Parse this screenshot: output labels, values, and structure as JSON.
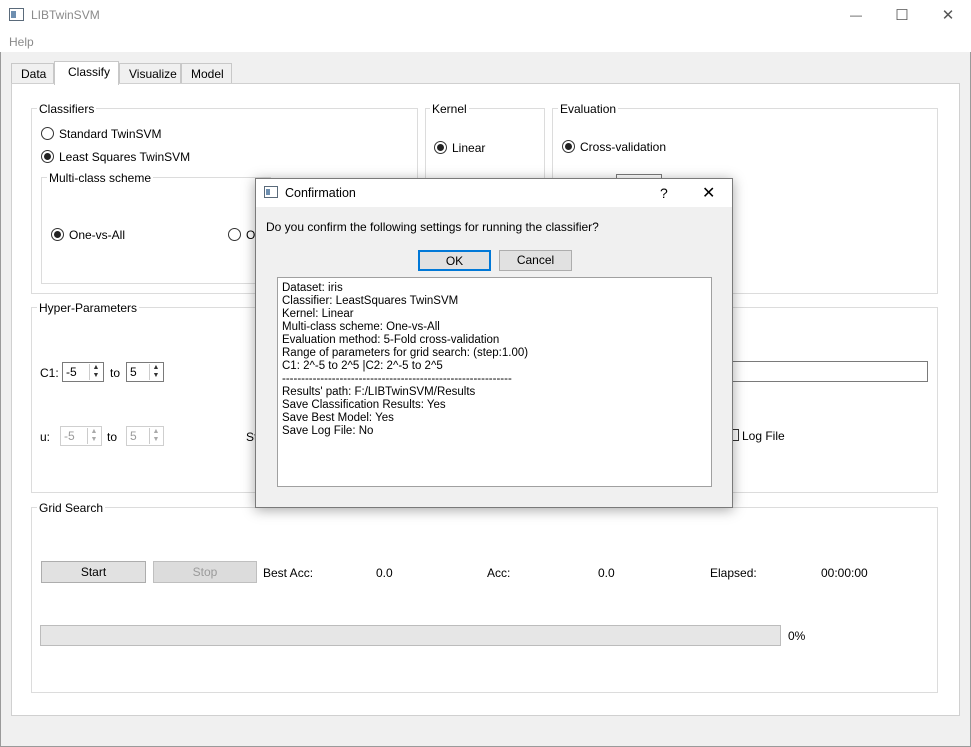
{
  "window": {
    "title": "LIBTwinSVM",
    "minimize": "—",
    "maximize": "☐",
    "close": "✕"
  },
  "menu": {
    "help": "Help"
  },
  "tabs": [
    "Data",
    "Classify",
    "Visualize",
    "Model"
  ],
  "classifiers": {
    "title": "Classifiers",
    "standard": "Standard TwinSVM",
    "least_squares": "Least Squares TwinSVM",
    "multiclass_title": "Multi-class scheme",
    "ova": "One-vs-All",
    "ovo_partial": "O"
  },
  "kernel": {
    "title": "Kernel",
    "linear": "Linear"
  },
  "evaluation": {
    "title": "Evaluation",
    "cv": "Cross-validation"
  },
  "hyper": {
    "title": "Hyper-Parameters",
    "c1_label": "C1:",
    "c1_from": "-5",
    "c1_to": "5",
    "to": "to",
    "u_label": "u:",
    "u_from": "-5",
    "u_to": "5",
    "st_partial": "St",
    "log_file": "Log File"
  },
  "grid": {
    "title": "Grid Search",
    "start": "Start",
    "stop": "Stop",
    "best_acc_label": "Best Acc:",
    "best_acc": "0.0",
    "acc_label": "Acc:",
    "acc": "0.0",
    "elapsed_label": "Elapsed:",
    "elapsed": "00:00:00",
    "progress_text": "0%",
    "progress_value": 0
  },
  "dialog": {
    "title": "Confirmation",
    "help": "?",
    "close": "✕",
    "question": "Do you confirm the following settings for running the classifier?",
    "ok": "OK",
    "cancel": "Cancel",
    "details": "Dataset: iris\nClassifier: LeastSquares TwinSVM\nKernel: Linear\nMulti-class scheme: One-vs-All\nEvaluation method: 5-Fold cross-validation\nRange of parameters for grid search: (step:1.00)\nC1: 2^-5 to 2^5 |C2: 2^-5 to 2^5\n------------------------------------------------------------\nResults' path: F:/LIBTwinSVM/Results\nSave Classification Results: Yes\nSave Best Model: Yes\nSave Log File: No"
  }
}
